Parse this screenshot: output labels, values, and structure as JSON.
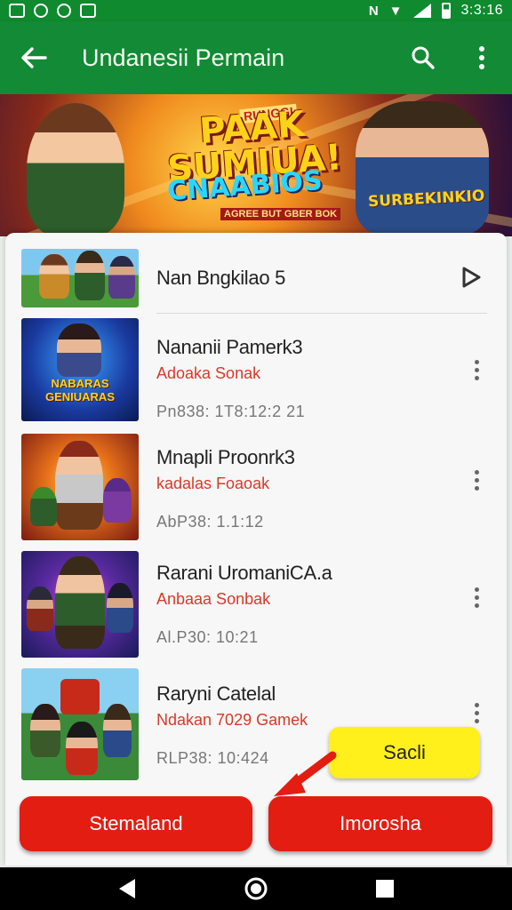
{
  "status_bar": {
    "time": "3:3:16"
  },
  "app_bar": {
    "title": "Undanesii Permain"
  },
  "banner": {
    "kicker": "RUNGGI",
    "title_line1": "PAAK",
    "title_line2": "SUMIUA!",
    "subtitle": "CNAABIOS",
    "tag": "AGREE BUT GBER BOK",
    "right_label": "SURBEKINKIO"
  },
  "list": {
    "top_item": {
      "title": "Nan Bngkilao 5"
    },
    "items": [
      {
        "title": "Nananii Pamerk3",
        "subtitle": "Adoaka Sonak",
        "meta": "Pn838: 1T8:12:2 21",
        "thumb_label": "NABARAS GENIUARAS"
      },
      {
        "title": "Mnapli Proonrk3",
        "subtitle": "kadalas Foaoak",
        "meta": "AbP38: 1.1:12"
      },
      {
        "title": "Rarani UromaniCA.a",
        "subtitle": "Anbaaa Sonbak",
        "meta": "Al.P30: 10:21"
      },
      {
        "title": "Raryni Catelal",
        "subtitle": "Ndakan 7029 Gamek",
        "meta": "RLP38: 10:424"
      }
    ]
  },
  "hint": {
    "label": "Sacli"
  },
  "buttons": {
    "left_label": "Stemaland",
    "right_label": "Imorosha"
  }
}
